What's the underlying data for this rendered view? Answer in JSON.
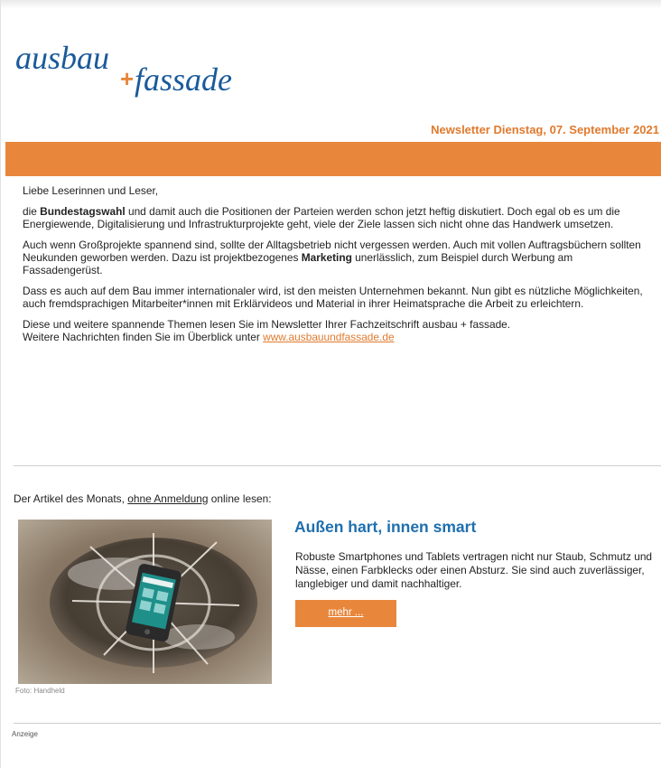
{
  "header": {
    "logo_text_part1": "ausbau",
    "logo_plus": "+",
    "logo_text_part2": "fassade",
    "dateline": "Newsletter Dienstag, 07. September 2021"
  },
  "body": {
    "greeting": "Liebe Leserinnen und Leser,",
    "p1_pre": "die ",
    "p1_bold": "Bundestagswahl",
    "p1_post": " und damit auch die Positionen der Parteien werden schon jetzt heftig diskutiert. Doch egal ob es um die Energiewende, Digitalisierung und Infrastrukturprojekte geht, viele der Ziele lassen sich nicht ohne das Handwerk umsetzen.",
    "p2_pre": "Auch wenn Großprojekte spannend sind, sollte der Alltagsbetrieb nicht vergessen werden. Auch mit vollen Auftragsbüchern sollten Neukunden geworben werden. Dazu ist projektbezogenes ",
    "p2_bold": "Marketing",
    "p2_post": " unerlässlich, zum Beispiel durch Werbung am Fassadengerüst.",
    "p3": "Dass es auch auf dem Bau immer internationaler wird, ist den meisten Unternehmen bekannt. Nun gibt es nützliche Möglichkeiten, auch fremdsprachigen Mitarbeiter*innen mit Erklärvideos und Material in ihrer Heimatsprache die Arbeit zu erleichtern.",
    "p4_line1": "Diese und weitere spannende Themen lesen Sie im Newsletter Ihrer Fachzeitschrift ausbau + fassade.",
    "p4_line2_pre": "Weitere Nachrichten finden Sie im Überblick unter ",
    "p4_link": "www.ausbauundfassade.de"
  },
  "article_of_month": {
    "intro_pre": "Der Artikel des Monats, ",
    "intro_link": "ohne Anmeldung",
    "intro_post": " online lesen:",
    "title": "Außen hart, innen smart",
    "description": "Robuste Smartphones und Tablets vertragen nicht nur Staub, Schmutz und Nässe, einen Farbklecks oder einen Absturz. Sie sind auch zuverlässiger, langlebiger und damit nachhaltiger.",
    "more_label": "mehr ...",
    "photo_credit": "Foto: Handheld"
  },
  "ad": {
    "label": "Anzeige"
  },
  "colors": {
    "accent_orange": "#e8873c",
    "title_blue": "#1f6fae",
    "logo_blue": "#1a5a9a"
  },
  "icons": [
    "logo",
    "phone-in-puddle-photo"
  ]
}
